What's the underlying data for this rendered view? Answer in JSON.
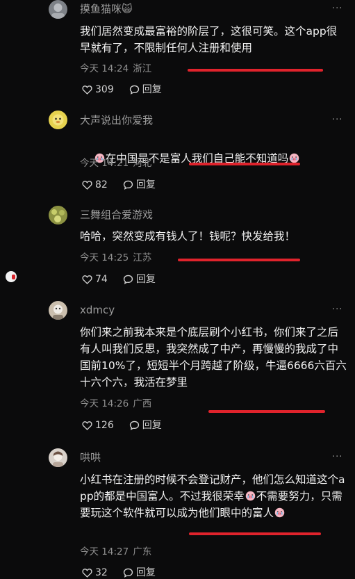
{
  "comments": [
    {
      "username": "摸鱼猫咪🙀",
      "text": "我们居然变成最富裕的阶层了，这很可笑。这个app很早就有了，不限制任何人注册和使用",
      "time": "今天 14:24",
      "location": "浙江",
      "likes": "309",
      "reply_label": "回复",
      "avatar_color": "#8a8e94"
    },
    {
      "username": "大声说出你爱我",
      "text_parts": [
        "",
        "在中国是不是富人我们自己能不知道吗",
        ""
      ],
      "emoji": "crying-pig-emoji",
      "time": "今天 14:21",
      "location": "河北",
      "likes": "82",
      "reply_label": "回复",
      "avatar_color": "#d8c24a"
    },
    {
      "username": "三舞组合爱游戏",
      "text": "哈哈，突然变成有钱人了！钱呢？快发给我！",
      "time": "今天 14:25",
      "location": "江苏",
      "likes": "74",
      "reply_label": "回复",
      "avatar_color": "#9aa04a"
    },
    {
      "username": "xdmcy",
      "text": "你们来之前我本来是个底层刷个小红书，你们来了之后有人叫我们反思，我突然成了中产，再慢慢的我成了中国前10%了，短短半个月跨越了阶级，牛逼6666六百六十六个六，我活在梦里",
      "time": "今天 14:26",
      "location": "广西",
      "likes": "126",
      "reply_label": "回复",
      "avatar_color": "#b8aa98"
    },
    {
      "username": "哄哄",
      "text_parts": [
        "小红书在注册的时候不会登记财产，他们怎么知道这个app的都是中国富人。不过我很荣幸",
        "不需要努力，只需要玩这个软件就可以成为他们眼中的富人",
        ""
      ],
      "emoji": "crying-pig-emoji",
      "time": "今天 14:27",
      "location": "广东",
      "likes": "32",
      "reply_label": "回复",
      "avatar_color": "#c9c2bb"
    }
  ],
  "more_icon": "ellipsis-icon",
  "like_icon": "heart-outline-icon",
  "reply_icon": "speech-bubble-icon",
  "underline_color": "#e0232c",
  "background": "#0b0b0c"
}
